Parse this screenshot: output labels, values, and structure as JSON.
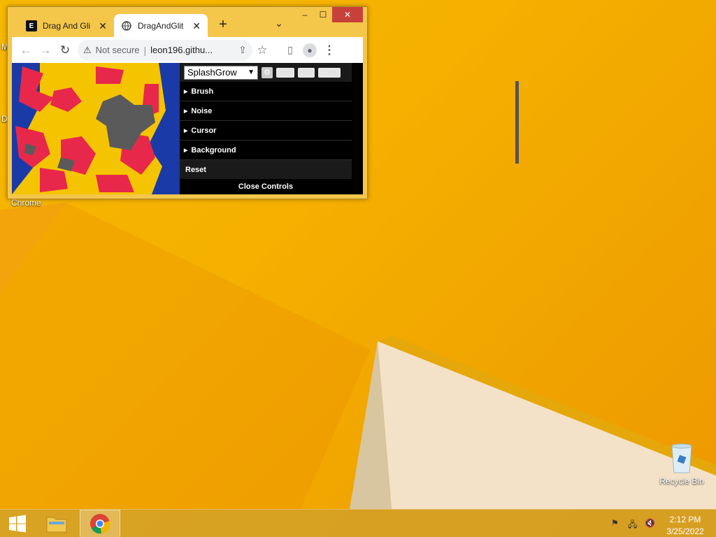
{
  "window": {
    "tabs": [
      {
        "favicon": "E",
        "title": "Drag And Gli"
      },
      {
        "favicon": "globe-icon",
        "title": "DragAndGlit"
      }
    ],
    "close_tab": "✕",
    "new_tab": "+",
    "tab_search": "⌄",
    "controls": {
      "minimize": "–",
      "maximize": "☐",
      "close": "✕"
    },
    "address": {
      "security": "Not secure",
      "url": "leon196.githu..."
    }
  },
  "app": {
    "preset": "SplashGrow",
    "buttons": {
      "save": "Save",
      "new": "New",
      "revert": "Revert"
    },
    "folders": [
      "Brush",
      "Noise",
      "Cursor",
      "Background"
    ],
    "reset": "Reset",
    "close_controls": "Close Controls"
  },
  "desktop": {
    "chrome_label": "Chrome",
    "recycle_bin": "Recycle Bin",
    "edge_letters": [
      "M",
      "D"
    ]
  },
  "taskbar": {
    "time": "2:12 PM",
    "date": "3/25/2022"
  },
  "colors": {
    "accent_red": "#e81123",
    "canvas_yellow": "#f5c400",
    "splash_red": "#e8284a",
    "splash_blue": "#1a3aa8"
  }
}
